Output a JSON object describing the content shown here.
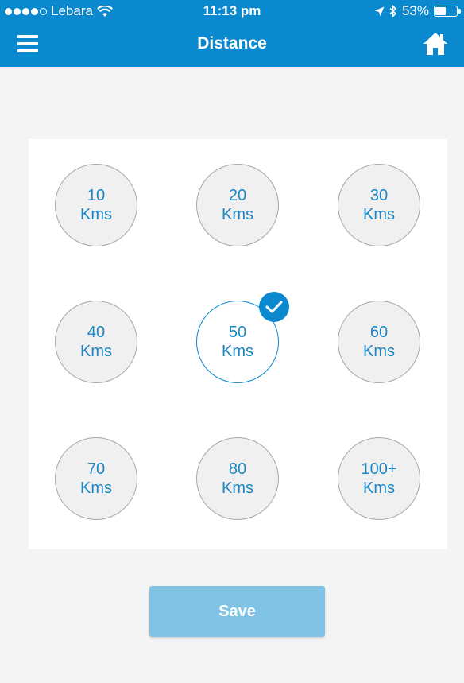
{
  "status_bar": {
    "carrier": "Lebara",
    "time": "11:13 pm",
    "battery_percent": "53%",
    "battery_level": 0.53,
    "icons": [
      "signal-dots-icon",
      "wifi-icon",
      "location-arrow-icon",
      "bluetooth-icon",
      "battery-icon"
    ]
  },
  "nav": {
    "title": "Distance",
    "left_icon": "menu-icon",
    "right_icon": "home-icon"
  },
  "options": [
    {
      "value": "10",
      "unit": "Kms",
      "selected": false
    },
    {
      "value": "20",
      "unit": "Kms",
      "selected": false
    },
    {
      "value": "30",
      "unit": "Kms",
      "selected": false
    },
    {
      "value": "40",
      "unit": "Kms",
      "selected": false
    },
    {
      "value": "50",
      "unit": "Kms",
      "selected": true
    },
    {
      "value": "60",
      "unit": "Kms",
      "selected": false
    },
    {
      "value": "70",
      "unit": "Kms",
      "selected": false
    },
    {
      "value": "80",
      "unit": "Kms",
      "selected": false
    },
    {
      "value": "100+",
      "unit": "Kms",
      "selected": false
    }
  ],
  "save_label": "Save",
  "colors": {
    "primary": "#0a89cf",
    "text_accent": "#1a86c4",
    "save_button": "#80c3e4",
    "background": "#f4f4f4"
  }
}
